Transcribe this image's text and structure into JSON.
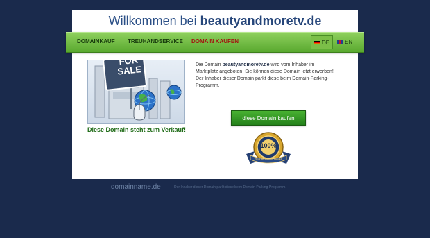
{
  "header": {
    "title_prefix": "Willkommen bei",
    "title_domain": "beautyandmoretv.de"
  },
  "nav": {
    "items": [
      {
        "label": "DOMAINKAUF",
        "active": false
      },
      {
        "label": "TREUHANDSERVICE",
        "active": false
      },
      {
        "label": "DOMAIN KAUFEN",
        "active": true
      }
    ],
    "languages": [
      {
        "code": "DE",
        "active": true,
        "icon": "flag-de-icon"
      },
      {
        "code": "EN",
        "active": false,
        "icon": "flag-gb-icon"
      }
    ]
  },
  "illustration": {
    "sign_text_line1": "FOR",
    "sign_text_line2": "SALE",
    "caption": "Diese Domain steht zum Verkauf!"
  },
  "description": {
    "line1_prefix": "Die Domain",
    "domain": "beautyandmoretv.de",
    "line1_suffix": "wird vom Inhaber im Marktplatz angeboten. Sie können diese Domain jetzt erwerben!",
    "line2": "Der Inhaber dieser Domain parkt diese beim Domain-Parking-Programm."
  },
  "buy_button": {
    "label": "diese Domain kaufen"
  },
  "seal": {
    "center_text": "100%",
    "ribbon_text": "TRUSTED DOMAIN DEALER"
  },
  "footer": {
    "logo": "domainname.de",
    "text": "Der Inhaber dieser Domain parkt diese beim Domain-Parking-Programm."
  },
  "colors": {
    "background": "#1a2a4c",
    "nav_green": "#59a92f",
    "button_green": "#23801a",
    "active_red": "#a3120f"
  }
}
